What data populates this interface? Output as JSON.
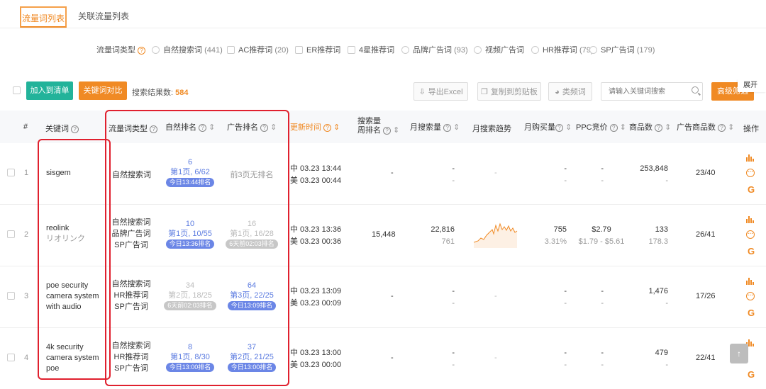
{
  "tabs": [
    {
      "label": "流量词列表",
      "active": true
    },
    {
      "label": "关联流量列表",
      "active": false
    }
  ],
  "filter": {
    "label": "流量词类型",
    "options": [
      {
        "name": "自然搜索词",
        "count": "(441)"
      },
      {
        "name": "AC推荐词",
        "count": "(20)"
      },
      {
        "name": "ER推荐词",
        "count": ""
      },
      {
        "name": "4星推荐词",
        "count": ""
      },
      {
        "name": "品牌广告词",
        "count": "(93)"
      },
      {
        "name": "视频广告词",
        "count": ""
      },
      {
        "name": "HR推荐词",
        "count": "(79)"
      },
      {
        "name": "SP广告词",
        "count": "(179)"
      }
    ]
  },
  "toolbar": {
    "add_label": "加入到清单",
    "compare_label": "关键词对比",
    "result_label": "搜索结果数:",
    "result_count": "584",
    "export_label": "导出Excel",
    "copy_label": "复制到剪贴板",
    "pie_label": "类频词",
    "search_placeholder": "请输入关键词搜索",
    "advanced_label": "高级筛选",
    "expand_label": "展开"
  },
  "columns": {
    "index": "#",
    "keyword": "关键词",
    "type": "流量词类型",
    "natural_rank": "自然排名",
    "ad_rank": "广告排名",
    "update_time": "更新时间",
    "search_week_rank_1": "搜索量",
    "search_week_rank_2": "周排名",
    "monthly_search": "月搜索量",
    "trend": "月搜索趋势",
    "monthly_purchase": "月购买量",
    "ppc": "PPC竞价",
    "products": "商品数",
    "ad_products": "广告商品数",
    "actions": "操作"
  },
  "rows": [
    {
      "index": "1",
      "keyword": "sisgem",
      "keyword_sub": "",
      "types": [
        "自然搜索词"
      ],
      "natural": {
        "rank": "6",
        "page": "第1页, 6/62",
        "badge": "今日13:44排名",
        "dim": false
      },
      "ad": {
        "rank": "",
        "page": "前3页无排名",
        "badge": "",
        "dim": true
      },
      "time_cn": "中 03.23 13:44",
      "time_us": "美 03.23 00:44",
      "week_rank": "-",
      "monthly_search": "-",
      "monthly_search_sub": "-",
      "trend": "-",
      "purchase": "-",
      "purchase_sub": "-",
      "ppc": "-",
      "ppc_sub": "-",
      "products": "253,848",
      "products_sub": "-",
      "ad_products": "23/40"
    },
    {
      "index": "2",
      "keyword": "reolink",
      "keyword_sub": "リオリンク",
      "types": [
        "自然搜索词",
        "品牌广告词",
        "SP广告词"
      ],
      "natural": {
        "rank": "10",
        "page": "第1页, 10/55",
        "badge": "今日13:36排名",
        "dim": false
      },
      "ad": {
        "rank": "16",
        "page": "第1页, 16/28",
        "badge": "6天前02:03排名",
        "dim": true
      },
      "time_cn": "中 03.23 13:36",
      "time_us": "美 03.23 00:36",
      "week_rank": "15,448",
      "monthly_search": "22,816",
      "monthly_search_sub": "761",
      "trend": "sparkline",
      "purchase": "755",
      "purchase_sub": "3.31%",
      "ppc": "$2.79",
      "ppc_sub": "$1.79 - $5.61",
      "products": "133",
      "products_sub": "178.3",
      "ad_products": "26/41"
    },
    {
      "index": "3",
      "keyword": "poe security camera system with audio",
      "keyword_lines": [
        "poe security",
        "camera system",
        "with audio"
      ],
      "keyword_sub": "",
      "types": [
        "自然搜索词",
        "HR推荐词",
        "SP广告词"
      ],
      "natural": {
        "rank": "34",
        "page": "第2页, 18/25",
        "badge": "6天前02:03排名",
        "dim": true
      },
      "ad": {
        "rank": "64",
        "page": "第3页, 22/25",
        "badge": "今日13:09排名",
        "dim": false
      },
      "time_cn": "中 03.23 13:09",
      "time_us": "美 03.23 00:09",
      "week_rank": "-",
      "monthly_search": "-",
      "monthly_search_sub": "-",
      "trend": "-",
      "purchase": "-",
      "purchase_sub": "-",
      "ppc": "-",
      "ppc_sub": "-",
      "products": "1,476",
      "products_sub": "-",
      "ad_products": "17/26"
    },
    {
      "index": "4",
      "keyword": "4k security camera system poe",
      "keyword_lines": [
        "4k security",
        "camera system",
        "poe"
      ],
      "keyword_sub": "",
      "types": [
        "自然搜索词",
        "HR推荐词",
        "SP广告词"
      ],
      "natural": {
        "rank": "8",
        "page": "第1页, 8/30",
        "badge": "今日13:00排名",
        "dim": false
      },
      "ad": {
        "rank": "37",
        "page": "第2页, 21/25",
        "badge": "今日13:00排名",
        "dim": false
      },
      "time_cn": "中 03.23 13:00",
      "time_us": "美 03.23 00:00",
      "week_rank": "-",
      "monthly_search": "-",
      "monthly_search_sub": "-",
      "trend": "-",
      "purchase": "-",
      "purchase_sub": "-",
      "ppc": "-",
      "ppc_sub": "-",
      "products": "479",
      "products_sub": "-",
      "ad_products": "22/41"
    }
  ],
  "colors": {
    "accent": "#f08a24",
    "green": "#22b39a",
    "rank_blue": "#5b7be0",
    "highlight_red": "#e0202e"
  },
  "icons": [
    "question-icon",
    "export-icon",
    "copy-icon",
    "pie-icon",
    "search-icon",
    "bars-chart-icon",
    "more-icon",
    "google-icon",
    "back-to-top-icon"
  ]
}
